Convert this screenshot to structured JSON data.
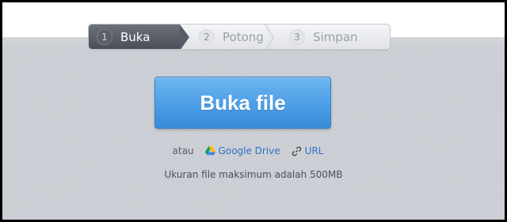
{
  "stepper": {
    "steps": [
      {
        "number": "1",
        "label": "Buka"
      },
      {
        "number": "2",
        "label": "Potong"
      },
      {
        "number": "3",
        "label": "Simpan"
      }
    ],
    "active_step": 1
  },
  "main": {
    "open_button_label": "Buka file",
    "alt_prefix": "atau",
    "google_drive_label": "Google Drive",
    "url_label": "URL",
    "max_size_note": "Ukuran file maksimum adalah 500MB"
  },
  "colors": {
    "button_blue": "#4c9ee6",
    "link_blue": "#2f72c4",
    "active_step": "#585d65"
  }
}
